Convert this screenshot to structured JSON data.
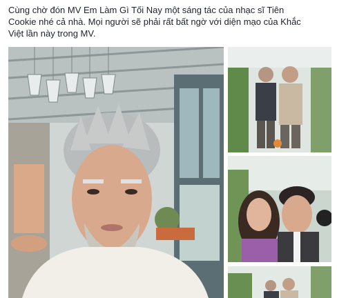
{
  "post": {
    "text_line1": "Cùng chờ đón MV Em Làm Gì Tối Nay một sáng tác của nhạc sĩ Tiên",
    "text_line2": "Cookie nhé cả nhà. Mọi người sẽ phải rất bất ngờ với diện mạo của Khắc",
    "text_line3": "Việt lần này trong MV."
  },
  "photos": [
    {
      "name": "main-photo",
      "subject": "man-with-aged-makeup"
    },
    {
      "name": "top-right-photo",
      "subject": "two-men-posing"
    },
    {
      "name": "middle-right-photo",
      "subject": "selfie-couple"
    },
    {
      "name": "bottom-right-photo",
      "subject": "two-men-partial"
    }
  ],
  "colors": {
    "text": "#1d2129",
    "background": "#ffffff"
  }
}
